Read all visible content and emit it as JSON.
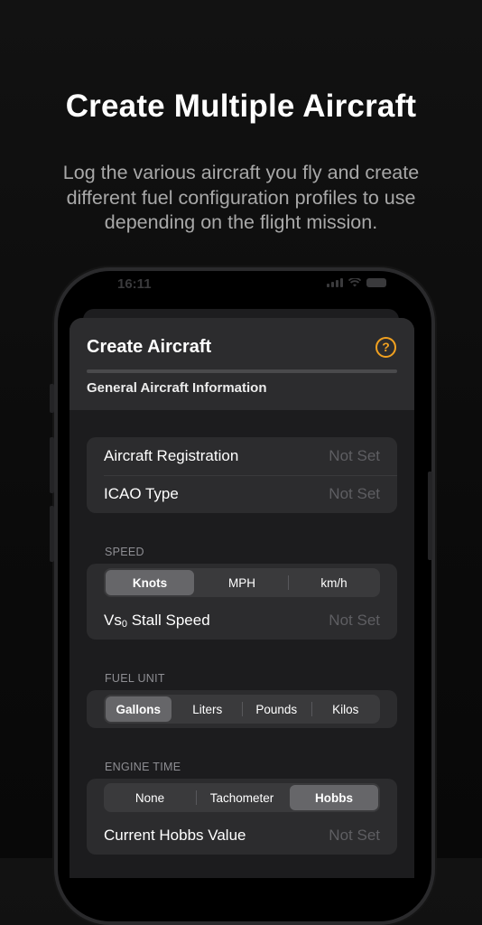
{
  "marketing": {
    "headline": "Create Multiple Aircraft",
    "subline": "Log the various aircraft you fly and create different fuel configuration profiles to use depending on the flight mission."
  },
  "status_bar": {
    "time": "16:11"
  },
  "sheet": {
    "title": "Create Aircraft",
    "section_tab": "General Aircraft Information",
    "help_glyph": "?"
  },
  "general": {
    "rows": [
      {
        "label": "Aircraft Registration",
        "value": "Not Set"
      },
      {
        "label": "ICAO Type",
        "value": "Not Set"
      }
    ]
  },
  "speed": {
    "section": "SPEED",
    "options": [
      "Knots",
      "MPH",
      "km/h"
    ],
    "selected": "Knots",
    "stall_label_main": "Vs",
    "stall_label_sub": "0",
    "stall_label_rest": " Stall Speed",
    "stall_value": "Not Set"
  },
  "fuel": {
    "section": "FUEL UNIT",
    "options": [
      "Gallons",
      "Liters",
      "Pounds",
      "Kilos"
    ],
    "selected": "Gallons"
  },
  "engine": {
    "section": "ENGINE TIME",
    "options": [
      "None",
      "Tachometer",
      "Hobbs"
    ],
    "selected": "Hobbs",
    "current_label": "Current Hobbs Value",
    "current_value": "Not Set"
  },
  "colors": {
    "accent": "#f0a020",
    "background": "#0e0e0e",
    "card": "#2c2c2e",
    "placeholder_text": "#5e5e62"
  }
}
